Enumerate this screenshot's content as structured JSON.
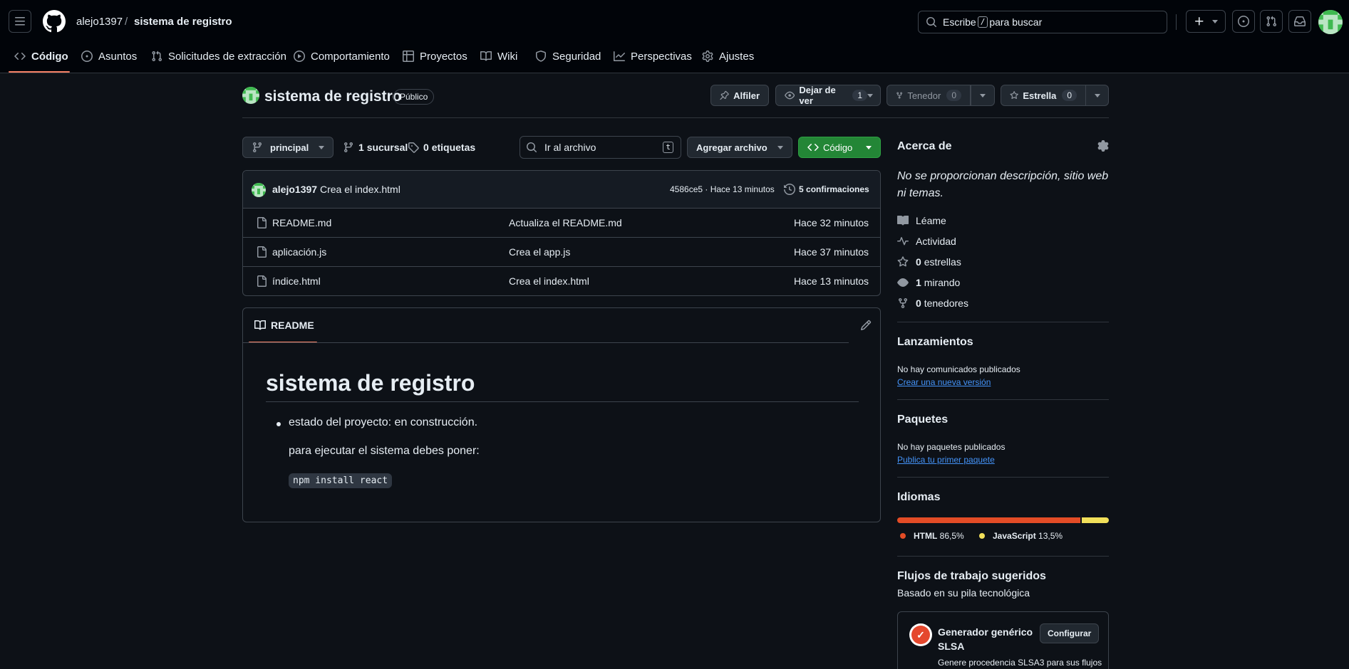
{
  "header": {
    "owner": "alejo1397",
    "separator": "/",
    "repo": "sistema de registro",
    "search_before": "Escribe",
    "search_key": "/",
    "search_after": "para buscar"
  },
  "tabs": [
    {
      "label": "Código",
      "icon": "code-icon"
    },
    {
      "label": "Asuntos",
      "icon": "issue-icon"
    },
    {
      "label": "Solicitudes de extracción",
      "icon": "pull-request-icon"
    },
    {
      "label": "Comportamiento",
      "icon": "play-icon"
    },
    {
      "label": "Proyectos",
      "icon": "table-icon"
    },
    {
      "label": "Wiki",
      "icon": "book-icon"
    },
    {
      "label": "Seguridad",
      "icon": "shield-icon"
    },
    {
      "label": "Perspectivas",
      "icon": "graph-icon"
    },
    {
      "label": "Ajustes",
      "icon": "gear-icon"
    }
  ],
  "repo_header": {
    "title": "sistema de registro",
    "visibility": "Público",
    "pin_label": "Alfiler",
    "watch_label": "Dejar de ver",
    "watch_count": "1",
    "fork_label": "Tenedor",
    "fork_count": "0",
    "star_label": "Estrella",
    "star_count": "0"
  },
  "branch_bar": {
    "branch": "principal",
    "branches_count": "1",
    "branches_label": "sucursal",
    "tags_count": "0",
    "tags_label": "etiquetas",
    "goto_file_placeholder": "Ir al archivo",
    "goto_file_key": "t",
    "add_file_label": "Agregar archivo",
    "code_label": "Código"
  },
  "latest_commit": {
    "author": "alejo1397",
    "message": "Crea el index.html",
    "sha_time": "4586ce5 · Hace 13 minutos",
    "commits_count": "5",
    "commits_label": "confirmaciones"
  },
  "files": [
    {
      "name": "README.md",
      "message": "Actualiza el README.md",
      "time": "Hace 32 minutos"
    },
    {
      "name": "aplicación.js",
      "message": "Crea el app.js",
      "time": "Hace 37 minutos"
    },
    {
      "name": "índice.html",
      "message": "Crea el index.html",
      "time": "Hace 13 minutos"
    }
  ],
  "readme": {
    "tab_label": "README",
    "heading": "sistema de registro",
    "bullet": "estado del proyecto: en construcción.",
    "paragraph": "para ejecutar el sistema debes poner:",
    "code": "npm install react"
  },
  "sidebar": {
    "about_title": "Acerca de",
    "about_desc": "No se proporcionan descripción, sitio web ni temas.",
    "readme_label": "Léame",
    "activity_label": "Actividad",
    "stars_count": "0",
    "stars_label": "estrellas",
    "watching_count": "1",
    "watching_label": "mirando",
    "forks_count": "0",
    "forks_label": "tenedores",
    "releases_title": "Lanzamientos",
    "releases_empty": "No hay comunicados publicados",
    "releases_link": "Crear una nueva versión",
    "packages_title": "Paquetes",
    "packages_empty": "No hay paquetes publicados",
    "packages_link": "Publica tu primer paquete",
    "languages_title": "Idiomas",
    "languages": [
      {
        "name": "HTML",
        "percent": "86,5%",
        "value": 86.5,
        "color": "#e34c26"
      },
      {
        "name": "JavaScript",
        "percent": "13,5%",
        "value": 13.5,
        "color": "#f1e05a"
      }
    ],
    "workflows_title": "Flujos de trabajo sugeridos",
    "workflows_subtitle": "Basado en su pila tecnológica",
    "workflow_name": "Generador genérico SLSA",
    "workflow_configure": "Configurar",
    "workflow_desc": "Genere procedencia SLSA3 para sus flujos"
  },
  "colors": {
    "accent_green": "#238636",
    "tab_underline": "#f78166",
    "link": "#4493f8"
  }
}
